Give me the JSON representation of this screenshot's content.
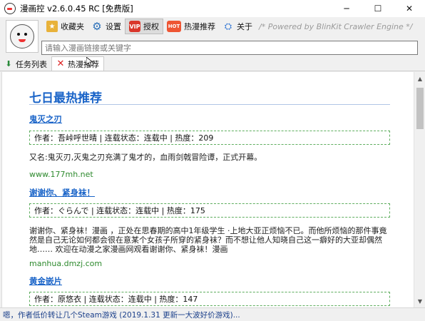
{
  "window": {
    "title": "漫画控 v2.6.0.45 RC [免费版]",
    "minimize_glyph": "─",
    "maximize_glyph": "☐",
    "close_glyph": "✕"
  },
  "toolbar": {
    "items": [
      {
        "label": "收藏夹",
        "icon": "favorites-icon"
      },
      {
        "label": "设置",
        "icon": "gear-icon"
      },
      {
        "label": "授权",
        "icon": "vip-icon"
      },
      {
        "label": "热漫推荐",
        "icon": "hot-icon",
        "badge": "HOT"
      },
      {
        "label": "关于",
        "icon": "about-icon"
      }
    ],
    "slogan": "/* Powered by BlinKit Crawler Engine */"
  },
  "search": {
    "placeholder": "请输入漫画链接或关键字",
    "value": ""
  },
  "tabs": [
    {
      "label": "任务列表",
      "icon": "download-icon",
      "active": false
    },
    {
      "label": "热漫推荐",
      "icon": "close-icon",
      "active": true
    }
  ],
  "content": {
    "heading": "七日最热推荐",
    "entries": [
      {
        "title": "鬼灭之刃",
        "info": "作者：吾峠呼世晴 | 连载状态：连载中 | 热度：209",
        "desc": "又名:鬼灭刃,灭鬼之刃充满了鬼才的，血雨剑戟冒险谭，正式开幕。",
        "site": "www.177mh.net"
      },
      {
        "title": "谢谢你、紧身袜！",
        "info": "作者：ぐらんで | 连载状态：连载中 | 热度：175",
        "desc": "谢谢你、紧身袜！漫画 ，正处在思春期的高中1年级学生 ·上地大亚正烦恼不已。而他所烦恼的那件事竟然是自己无论如何都会很在意某个女孩子所穿的紧身袜？而不想让他人知晓自己这一癖好的大亚却偶然地…… 欢迎在动漫之家漫画网观看谢谢你、紧身袜！漫画",
        "site": "manhua.dmzj.com"
      },
      {
        "title": "黄金嵌片",
        "info": "作者：原悠衣 | 连载状态：连载中 | 热度：147",
        "desc": "",
        "site": ""
      }
    ]
  },
  "status": {
    "text": "嗯，作者低价转让几个Steam游戏 (2019.1.31 更新一大波好价游戏)..."
  }
}
